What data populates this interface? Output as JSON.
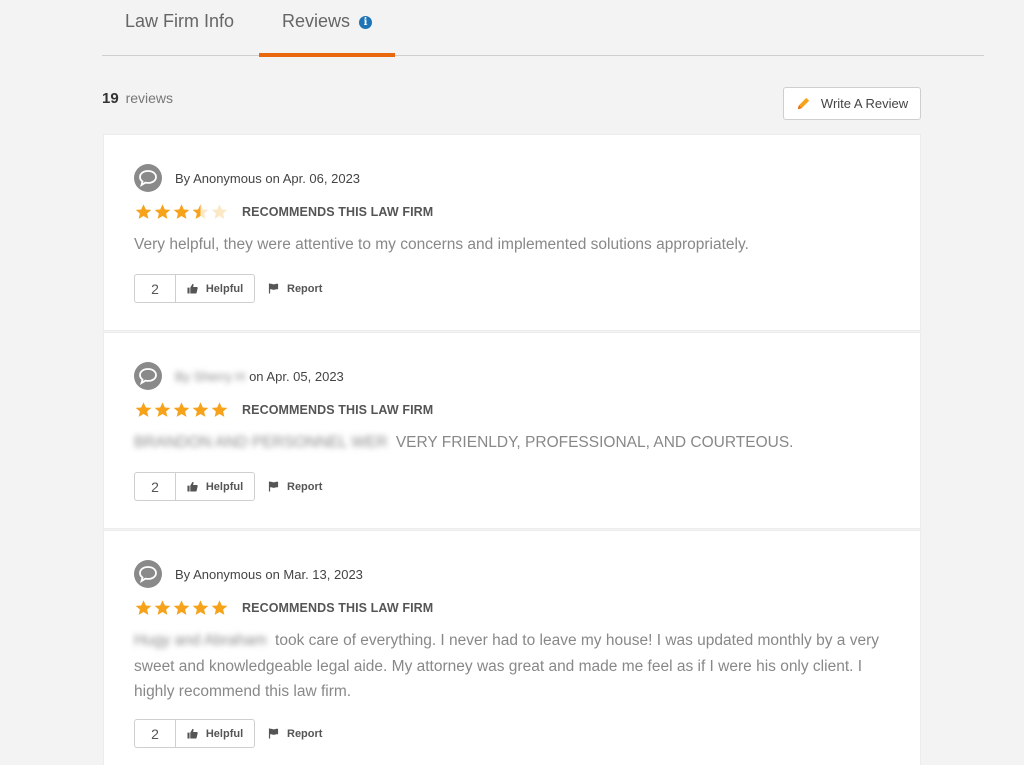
{
  "tabs": [
    {
      "label": "Law Firm Info"
    },
    {
      "label": "Reviews"
    }
  ],
  "summary": {
    "count": "19",
    "count_label": "reviews"
  },
  "write_review_label": "Write A Review",
  "colors": {
    "accent": "#e8670f",
    "star": "#f7a21b",
    "info": "#1e74b4"
  },
  "reviews": [
    {
      "author": "By Anonymous",
      "date": "on Apr. 06, 2023",
      "rating": 3.5,
      "recommendation": "RECOMMENDS THIS LAW FIRM",
      "text": "Very helpful, they were attentive to my concerns and implemented solutions appropriately.",
      "helpful_count": "2",
      "helpful_label": "Helpful",
      "report_label": "Report"
    },
    {
      "author": "By Sherry H",
      "date": "on Apr. 05, 2023",
      "rating": 5,
      "recommendation": "RECOMMENDS THIS LAW FIRM",
      "text_redacted": "BRANDON AND PERSONNEL WER",
      "text": "VERY FRIENLDY, PROFESSIONAL, AND COURTEOUS.",
      "helpful_count": "2",
      "helpful_label": "Helpful",
      "report_label": "Report"
    },
    {
      "author": "By Anonymous",
      "date": "on Mar. 13, 2023",
      "rating": 5,
      "recommendation": "RECOMMENDS THIS LAW FIRM",
      "text_redacted": "Hugy and Abraham",
      "text": "took care of everything. I never had to leave my house! I was updated monthly by a very sweet and knowledgeable legal aide. My attorney was great and made me feel as if I were his only client. I highly recommend this law firm.",
      "helpful_count": "2",
      "helpful_label": "Helpful",
      "report_label": "Report"
    }
  ]
}
